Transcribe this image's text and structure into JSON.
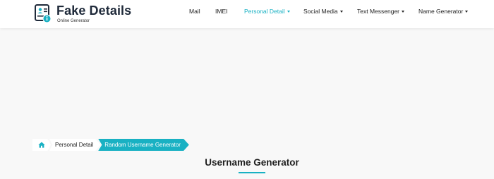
{
  "brand": {
    "title": "Fake Details",
    "subtitle": "Online Generator",
    "accent_color": "#19b1c3"
  },
  "nav": {
    "items": [
      {
        "label": "Mail",
        "has_dropdown": false,
        "active": false
      },
      {
        "label": "IMEI",
        "has_dropdown": false,
        "active": false
      },
      {
        "label": "Personal Detail",
        "has_dropdown": true,
        "active": true
      },
      {
        "label": "Social Media",
        "has_dropdown": true,
        "active": false
      },
      {
        "label": "Text Messenger",
        "has_dropdown": true,
        "active": false
      },
      {
        "label": "Name Generator",
        "has_dropdown": true,
        "active": false
      }
    ]
  },
  "breadcrumb": {
    "home_icon": "home-icon",
    "parent": "Personal Detail",
    "current": "Random Username Generator"
  },
  "main": {
    "title": "Username Generator"
  }
}
